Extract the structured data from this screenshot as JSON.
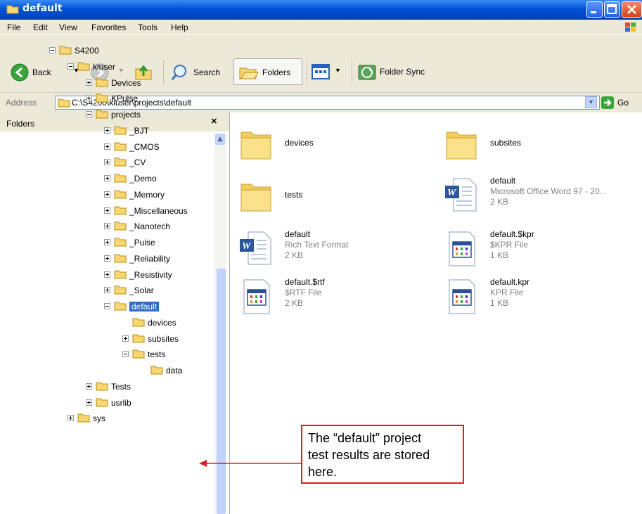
{
  "window": {
    "title": "default"
  },
  "menu": [
    "File",
    "Edit",
    "View",
    "Favorites",
    "Tools",
    "Help"
  ],
  "toolbar": {
    "back": "Back",
    "search": "Search",
    "folders": "Folders",
    "folder_sync": "Folder Sync"
  },
  "address": {
    "label": "Address",
    "path": "C:\\S4200\\kiuser\\projects\\default",
    "go": "Go"
  },
  "tree_pane": {
    "title": "Folders",
    "close": "×"
  },
  "tree": [
    {
      "label": "S4200",
      "pm": "minus"
    },
    {
      "label": "kiuser",
      "pm": "minus"
    },
    {
      "label": "Devices",
      "pm": "plus"
    },
    {
      "label": "KPulse",
      "pm": "plus"
    },
    {
      "label": "projects",
      "pm": "minus"
    },
    {
      "label": "_BJT",
      "pm": "plus"
    },
    {
      "label": "_CMOS",
      "pm": "plus"
    },
    {
      "label": "_CV",
      "pm": "plus"
    },
    {
      "label": "_Demo",
      "pm": "plus"
    },
    {
      "label": "_Memory",
      "pm": "plus"
    },
    {
      "label": "_Miscellaneous",
      "pm": "plus"
    },
    {
      "label": "_Nanotech",
      "pm": "plus"
    },
    {
      "label": "_Pulse",
      "pm": "plus"
    },
    {
      "label": "_Reliability",
      "pm": "plus"
    },
    {
      "label": "_Resistivity",
      "pm": "plus"
    },
    {
      "label": "_Solar",
      "pm": "plus"
    },
    {
      "label": "default",
      "pm": "minus",
      "selected": true
    },
    {
      "label": "devices",
      "pm": "none"
    },
    {
      "label": "subsites",
      "pm": "plus"
    },
    {
      "label": "tests",
      "pm": "minus"
    },
    {
      "label": "data",
      "pm": "none"
    },
    {
      "label": "Tests",
      "pm": "plus"
    },
    {
      "label": "usrlib",
      "pm": "plus"
    },
    {
      "label": "sys",
      "pm": "plus"
    }
  ],
  "files": [
    {
      "name": "devices",
      "kind": "folder"
    },
    {
      "name": "subsites",
      "kind": "folder"
    },
    {
      "name": "tests",
      "kind": "folder"
    },
    {
      "name": "default",
      "type": "Microsoft Office Word 97 - 20...",
      "size": "2 KB",
      "kind": "word"
    },
    {
      "name": "default",
      "type": "Rich Text Format",
      "size": "2 KB",
      "kind": "word"
    },
    {
      "name": "default.$kpr",
      "type": "$KPR File",
      "size": "1 KB",
      "kind": "app"
    },
    {
      "name": "default.$rtf",
      "type": "$RTF File",
      "size": "2 KB",
      "kind": "app"
    },
    {
      "name": "default.kpr",
      "type": "KPR File",
      "size": "1 KB",
      "kind": "app"
    }
  ],
  "callout": {
    "text": "The “default” project test results are stored here.",
    "line1": "The “default” project",
    "line2": "test results are stored",
    "line3": "here.",
    "color": "#e11d24"
  },
  "colors": {
    "titlebar": "#0052d6",
    "selection": "#316ac5",
    "folder": "#f7d774"
  }
}
